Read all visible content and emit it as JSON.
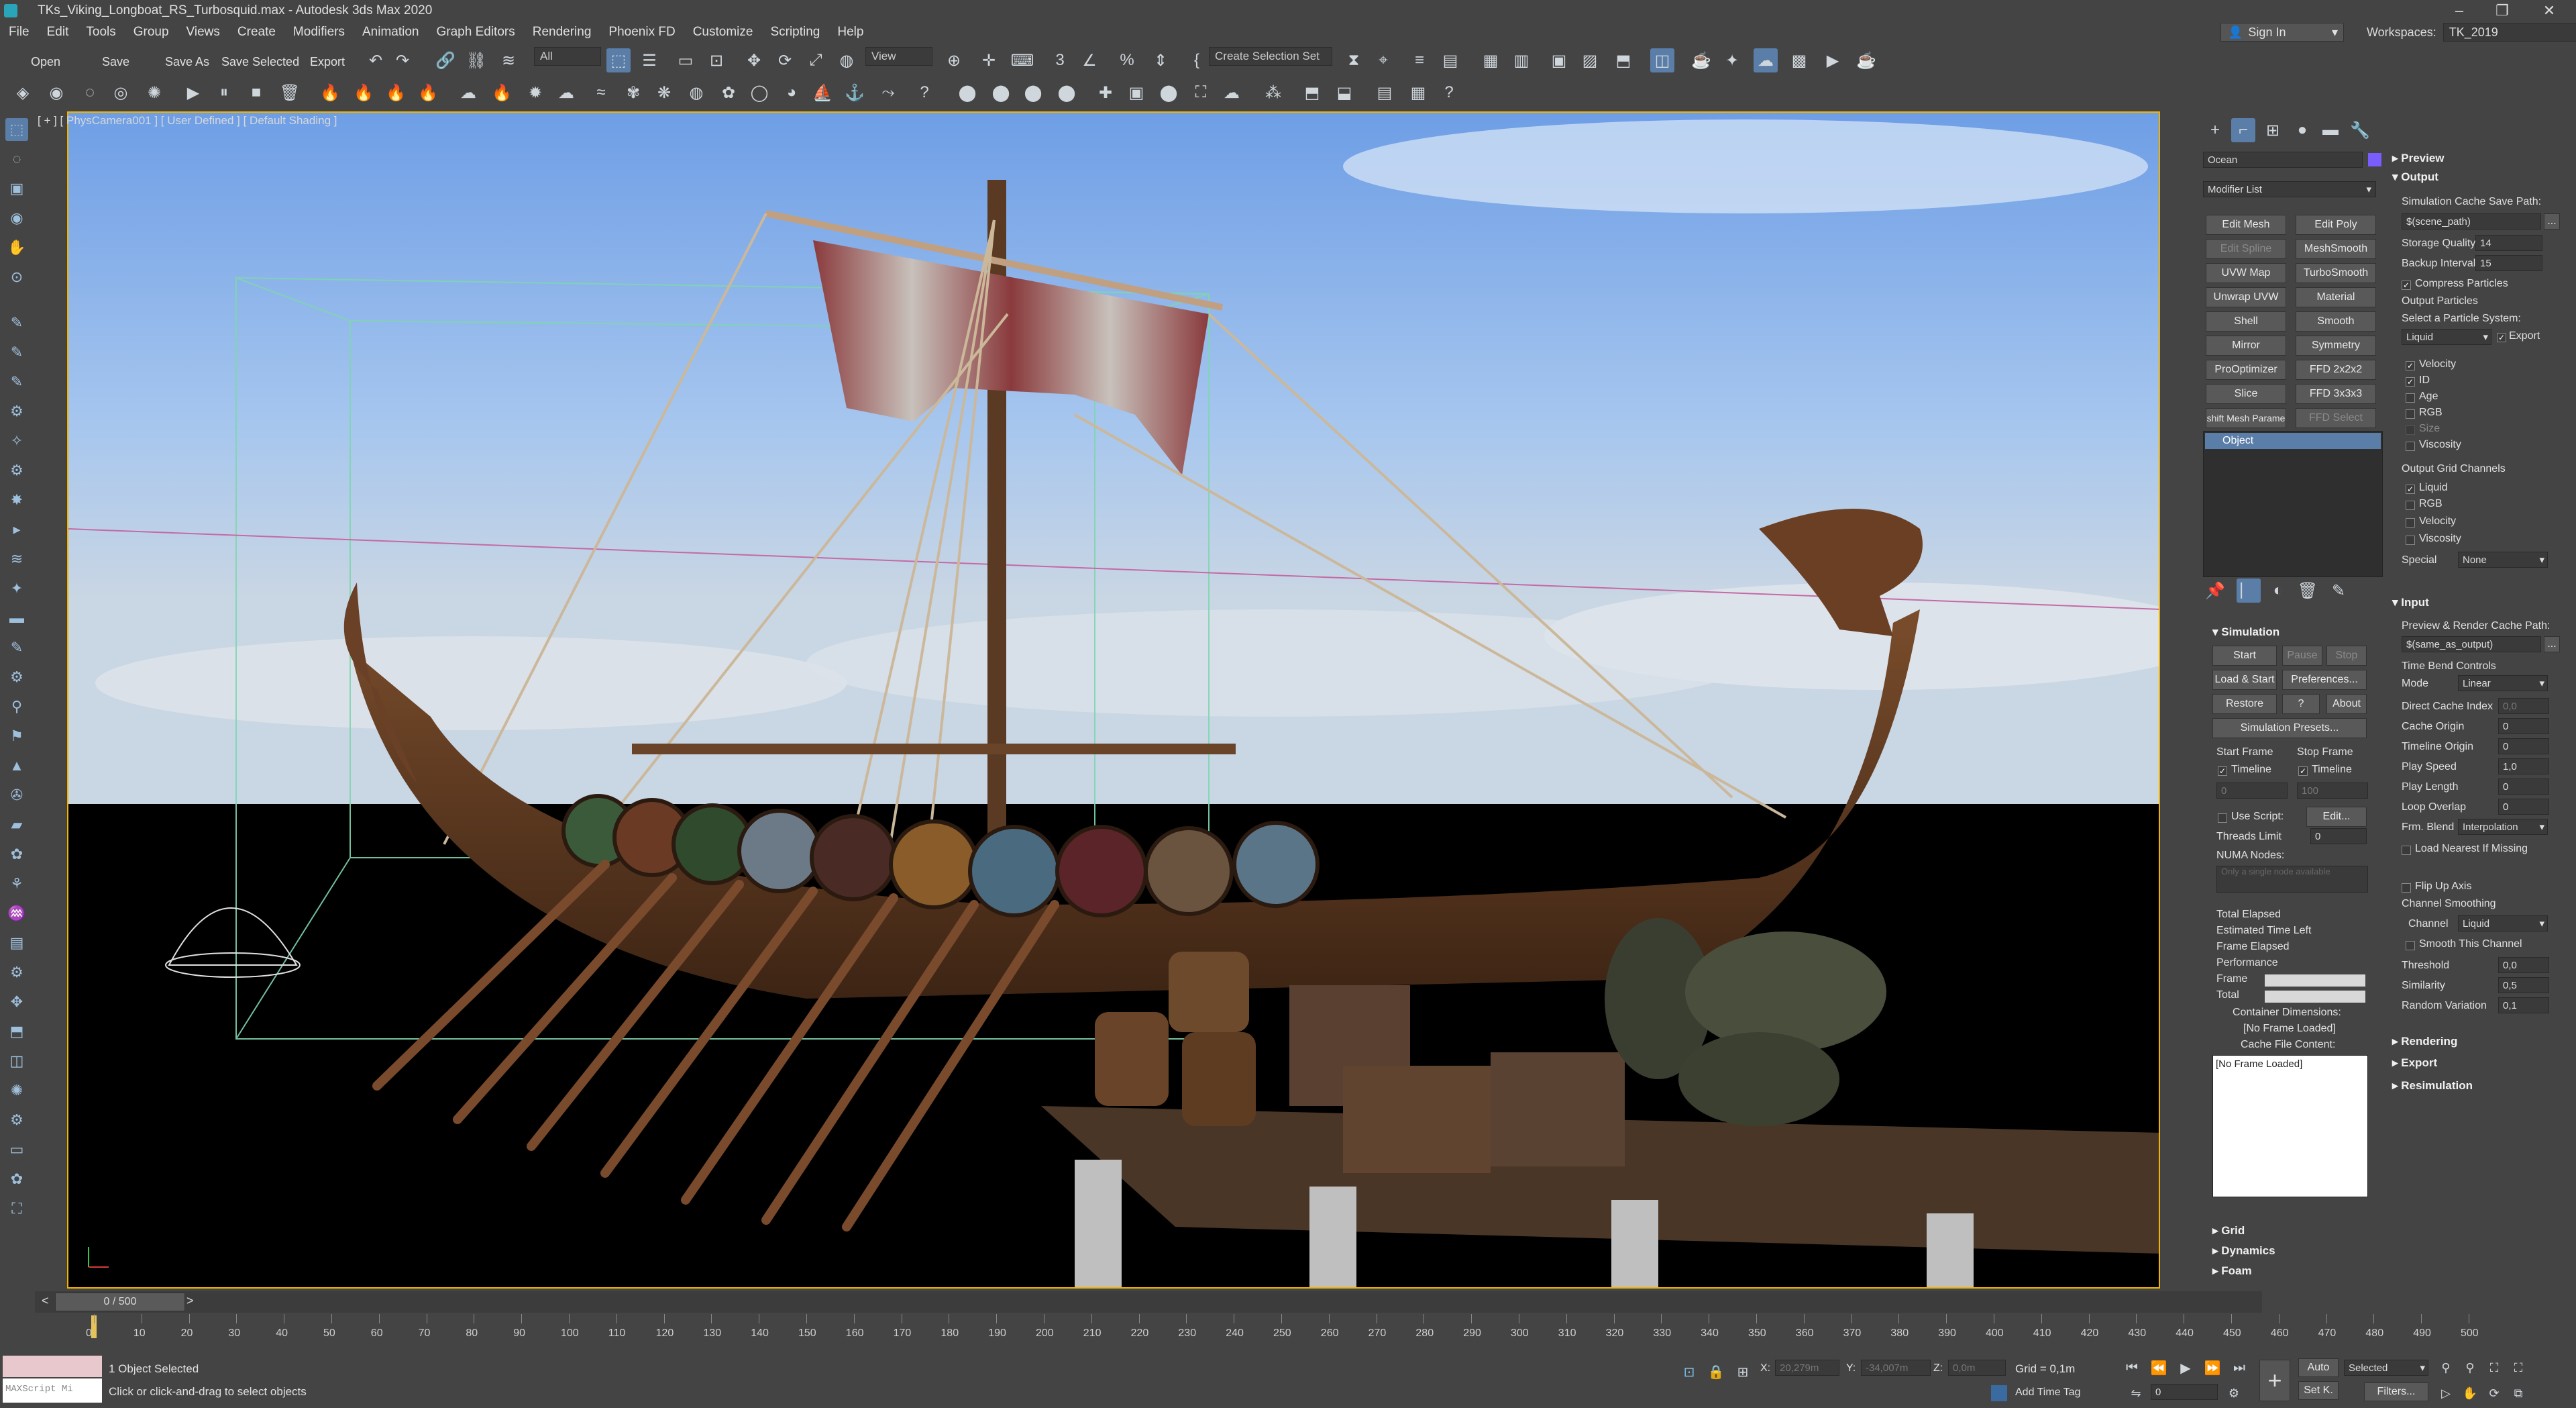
{
  "window": {
    "title": "TKs_Viking_Longboat_RS_Turbosquid.max - Autodesk 3ds Max 2020",
    "controls": [
      "–",
      "❐",
      "✕"
    ]
  },
  "menu": {
    "items": [
      "File",
      "Edit",
      "Tools",
      "Group",
      "Views",
      "Create",
      "Modifiers",
      "Animation",
      "Graph Editors",
      "Rendering",
      "Phoenix FD",
      "Customize",
      "Scripting",
      "Help"
    ]
  },
  "account": {
    "sign_in": "Sign In",
    "workspaces_label": "Workspaces:",
    "workspace_value": "TK_2019"
  },
  "toolbar": {
    "open": "Open",
    "save": "Save",
    "save_as": "Save As",
    "save_selected": "Save Selected",
    "export": "Export",
    "filter_value": "All",
    "ref_coord": "View",
    "selection_set": "Create Selection Set"
  },
  "viewport": {
    "label": "[ + ] [ PhysCamera001 ] [ User Defined ] [ Default Shading ]",
    "accent_color": "#f0b400"
  },
  "command_panel": {
    "object_name": "Ocean",
    "object_color": "#7b5cff",
    "modifier_list": "Modifier List",
    "modifier_buttons": [
      [
        "Edit Mesh",
        "Edit Poly"
      ],
      [
        "Edit Spline",
        "MeshSmooth"
      ],
      [
        "UVW Map",
        "TurboSmooth"
      ],
      [
        "Unwrap UVW",
        "Material"
      ],
      [
        "Shell",
        "Smooth"
      ],
      [
        "Mirror",
        "Symmetry"
      ],
      [
        "ProOptimizer",
        "FFD 2x2x2"
      ],
      [
        "Slice",
        "FFD 3x3x3"
      ],
      [
        "shift Mesh Parame",
        "FFD Select"
      ]
    ],
    "stack_item": "Object",
    "simulation": {
      "header": "Simulation",
      "start": "Start",
      "pause": "Pause",
      "stop": "Stop",
      "load_start": "Load & Start",
      "preferences": "Preferences...",
      "restore": "Restore",
      "help": "?",
      "about": "About",
      "presets": "Simulation Presets...",
      "start_frame": "Start Frame",
      "stop_frame": "Stop Frame",
      "timeline_a": "Timeline",
      "timeline_b": "Timeline",
      "start_value": "0",
      "stop_value": "100",
      "use_script": "Use Script:",
      "edit": "Edit...",
      "threads_limit": "Threads Limit",
      "threads_value": "0",
      "numa_nodes": "NUMA Nodes:",
      "numa_placeholder": "Only a single node available",
      "total_elapsed": "Total Elapsed",
      "estimated_left": "Estimated Time Left",
      "frame_elapsed": "Frame Elapsed",
      "performance": "Performance",
      "frame": "Frame",
      "total": "Total",
      "container_dims": "Container Dimensions:",
      "no_frame_loaded": "[No Frame Loaded]",
      "cache_file_content": "Cache File Content:",
      "cache_list": "[No Frame Loaded]"
    },
    "bottom_rollouts": [
      "Grid",
      "Dynamics",
      "Foam"
    ]
  },
  "rollouts": {
    "preview": "Preview",
    "output": {
      "header": "Output",
      "cache_save_path": "Simulation Cache Save Path:",
      "cache_path_value": "$(scene_path)",
      "browse": "...",
      "storage_quality": "Storage Quality",
      "storage_quality_value": "14",
      "backup_interval": "Backup Interval",
      "backup_interval_value": "15",
      "compress_particles": "Compress Particles",
      "output_particles": "Output Particles",
      "select_particle_system": "Select a Particle System:",
      "particle_system": "Liquid",
      "export": "Export",
      "particle_channels": [
        {
          "label": "Velocity",
          "checked": true,
          "dim": false
        },
        {
          "label": "ID",
          "checked": true,
          "dim": false
        },
        {
          "label": "Age",
          "checked": false,
          "dim": false
        },
        {
          "label": "RGB",
          "checked": false,
          "dim": false
        },
        {
          "label": "Size",
          "checked": false,
          "dim": true
        },
        {
          "label": "Viscosity",
          "checked": false,
          "dim": false
        }
      ],
      "grid_channels_label": "Output Grid Channels",
      "grid_channels": [
        {
          "label": "Liquid",
          "checked": true
        },
        {
          "label": "RGB",
          "checked": false
        },
        {
          "label": "Velocity",
          "checked": false
        },
        {
          "label": "Viscosity",
          "checked": false
        }
      ],
      "special": "Special",
      "special_value": "None"
    },
    "input": {
      "header": "Input",
      "render_cache_path": "Preview & Render Cache Path:",
      "render_cache_value": "$(same_as_output)",
      "time_bend": "Time Bend Controls",
      "mode": "Mode",
      "mode_value": "Linear",
      "direct_cache_index": "Direct Cache Index",
      "direct_cache_value": "0,0",
      "cache_origin": "Cache Origin",
      "cache_origin_value": "0",
      "timeline_origin": "Timeline Origin",
      "timeline_origin_value": "0",
      "play_speed": "Play Speed",
      "play_speed_value": "1,0",
      "play_length": "Play Length",
      "play_length_value": "0",
      "loop_overlap": "Loop Overlap",
      "loop_overlap_value": "0",
      "frm_blend": "Frm. Blend",
      "frm_blend_value": "Interpolation",
      "load_nearest": "Load Nearest If Missing",
      "flip_up_axis": "Flip Up Axis",
      "channel_smoothing": "Channel Smoothing",
      "channel": "Channel",
      "channel_value": "Liquid",
      "smooth_this_channel": "Smooth This Channel",
      "threshold": "Threshold",
      "threshold_value": "0,0",
      "similarity": "Similarity",
      "similarity_value": "0,5",
      "random_variation": "Random Variation",
      "random_variation_value": "0,1"
    },
    "collapsed": [
      "Rendering",
      "Export",
      "Resimulation"
    ]
  },
  "timeline": {
    "frame_display": "0 / 500",
    "ticks": [
      "0",
      "10",
      "20",
      "30",
      "40",
      "50",
      "60",
      "70",
      "80",
      "90",
      "100",
      "110",
      "120",
      "130",
      "140",
      "150",
      "160",
      "170",
      "180",
      "190",
      "200",
      "210",
      "220",
      "230",
      "240",
      "250",
      "260",
      "270",
      "280",
      "290",
      "300",
      "310",
      "320",
      "330",
      "340",
      "350",
      "360",
      "370",
      "380",
      "390",
      "400",
      "410",
      "420",
      "430",
      "440",
      "450",
      "460",
      "470",
      "480",
      "490",
      "500"
    ]
  },
  "status": {
    "maxscript": "MAXScript Mi",
    "selection": "1 Object Selected",
    "prompt": "Click or click-and-drag to select objects",
    "x_label": "X:",
    "x_value": "20,279m",
    "y_label": "Y:",
    "y_value": "-34,007m",
    "z_label": "Z:",
    "z_value": "0,0m",
    "grid": "Grid = 0,1m",
    "add_time_tag": "Add Time Tag",
    "auto": "Auto",
    "set_k": "Set K.",
    "selected": "Selected",
    "filters": "Filters...",
    "frame_value": "0"
  }
}
